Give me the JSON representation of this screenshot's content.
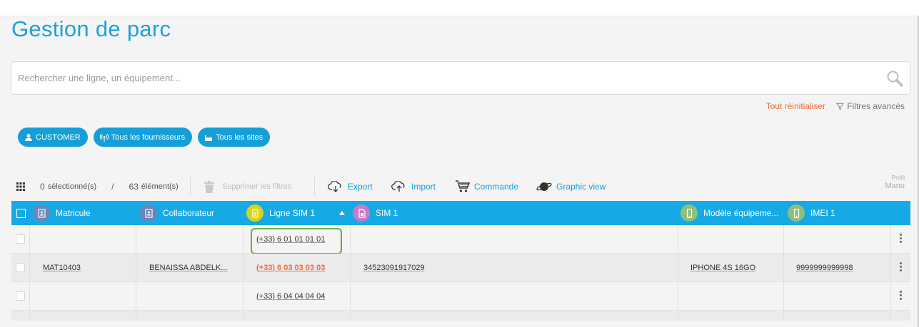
{
  "page": {
    "title": "Gestion de parc"
  },
  "search": {
    "placeholder": "Rechercher une ligne, un équipement..."
  },
  "filters": {
    "reset_label": "Tout réinitialiser",
    "advanced_label": "Filtres avancés"
  },
  "chips": [
    {
      "label": "CUSTOMER",
      "icon": "user-icon"
    },
    {
      "label": "Tous les fournisseurs",
      "icon": "antenna-icon"
    },
    {
      "label": "Tous les sites",
      "icon": "factory-icon"
    }
  ],
  "toolbar": {
    "selected_count": "0",
    "selected_label": "sélectionné(s)",
    "separator": "/",
    "total_count": "63",
    "total_label": "élément(s)",
    "delete_filters_label": "Supprimer les filtres",
    "export_label": "Export",
    "import_label": "Import",
    "order_label": "Commande",
    "graphic_view_label": "Graphic view",
    "profile_small": "Profil",
    "profile_value": "Manu"
  },
  "table": {
    "columns": [
      {
        "label": "Matricule",
        "icon": "contact-book-icon",
        "color": "#6b86b8"
      },
      {
        "label": "Collaborateur",
        "icon": "contact-book-icon",
        "color": "#6b86b8"
      },
      {
        "label": "Ligne SIM 1",
        "icon": "sim-line-icon",
        "color": "#d7d31c",
        "sorted": "asc"
      },
      {
        "label": "SIM 1",
        "icon": "sim-card-icon",
        "color": "#c77cc6"
      },
      {
        "label": "Modèle équipeme...",
        "icon": "phone-icon",
        "color": "#8fbf7a"
      },
      {
        "label": "IMEI 1",
        "icon": "phone-icon",
        "color": "#8fbf7a"
      }
    ],
    "rows": [
      {
        "matricule": "",
        "collaborateur": "",
        "ligne": "(+33) 6 01 01 01 01",
        "sim": "",
        "modele": "",
        "imei": ""
      },
      {
        "matricule": "MAT10403",
        "collaborateur": "BENAISSA ABDELK...",
        "ligne": "(+33) 6 03 03 03 03",
        "sim": "34523091917029",
        "modele": "IPHONE 4S 16GO",
        "imei": "9999999999998"
      },
      {
        "matricule": "",
        "collaborateur": "",
        "ligne": "(+33) 6 04 04 04 04",
        "sim": "",
        "modele": "",
        "imei": ""
      }
    ]
  },
  "colors": {
    "accent": "#159fd8",
    "header": "#16a9e6",
    "link_orange": "#ef6a3b",
    "focus_green": "#6aa84f"
  }
}
